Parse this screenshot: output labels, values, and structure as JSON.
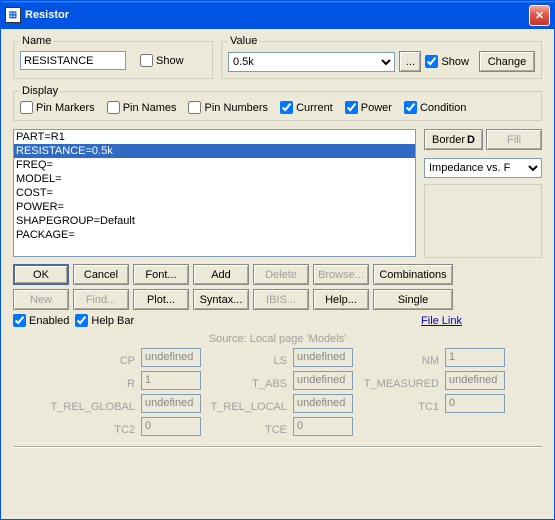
{
  "window": {
    "title": "Resistor"
  },
  "name_group": {
    "legend": "Name",
    "value": "RESISTANCE",
    "show_label": "Show",
    "show_checked": false
  },
  "value_group": {
    "legend": "Value",
    "value": "0.5k",
    "dot_label": "...",
    "show_label": "Show",
    "show_checked": true,
    "change_label": "Change"
  },
  "display_group": {
    "legend": "Display",
    "pin_markers": {
      "label": "Pin Markers",
      "checked": false
    },
    "pin_names": {
      "label": "Pin Names",
      "checked": false
    },
    "pin_numbers": {
      "label": "Pin Numbers",
      "checked": false
    },
    "current": {
      "label": "Current",
      "checked": true
    },
    "power": {
      "label": "Power",
      "checked": true
    },
    "condition": {
      "label": "Condition",
      "checked": true
    }
  },
  "listbox": {
    "items": [
      "PART=R1",
      "RESISTANCE=0.5k",
      "FREQ=",
      "MODEL=",
      "COST=",
      "POWER=",
      "SHAPEGROUP=Default",
      "PACKAGE="
    ],
    "selected_index": 1
  },
  "rightpane": {
    "border_label": "Border",
    "fill_label": "Fill",
    "plot_type": "Impedance vs. F"
  },
  "buttons": {
    "row1": [
      "OK",
      "Cancel",
      "Font...",
      "Add",
      "Delete",
      "Browse...",
      "Combinations"
    ],
    "row1_disabled": [
      false,
      false,
      false,
      false,
      true,
      true,
      false
    ],
    "row2": [
      "New",
      "Find...",
      "Plot...",
      "Syntax...",
      "IBIS...",
      "Help...",
      "Single"
    ],
    "row2_disabled": [
      true,
      true,
      false,
      false,
      true,
      false,
      false
    ]
  },
  "enabled_chk": {
    "label": "Enabled",
    "checked": true
  },
  "helpbar_chk": {
    "label": "Help Bar",
    "checked": true
  },
  "file_link": "File Link",
  "source": {
    "header": "Source: Local page 'Models'",
    "fields": [
      {
        "label": "CP",
        "value": "undefined"
      },
      {
        "label": "LS",
        "value": "undefined"
      },
      {
        "label": "NM",
        "value": "1"
      },
      {
        "label": "R",
        "value": "1"
      },
      {
        "label": "T_ABS",
        "value": "undefined"
      },
      {
        "label": "T_MEASURED",
        "value": "undefined"
      },
      {
        "label": "T_REL_GLOBAL",
        "value": "undefined"
      },
      {
        "label": "T_REL_LOCAL",
        "value": "undefined"
      },
      {
        "label": "TC1",
        "value": "0"
      },
      {
        "label": "TC2",
        "value": "0"
      },
      {
        "label": "TCE",
        "value": "0"
      }
    ]
  }
}
